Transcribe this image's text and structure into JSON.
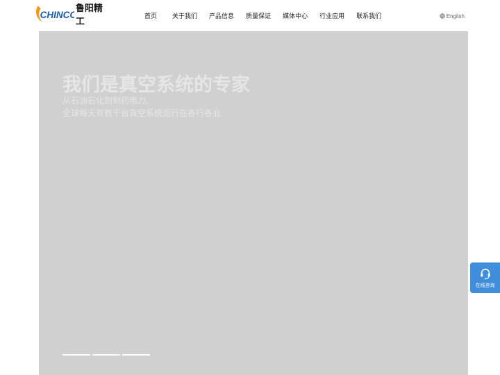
{
  "header": {
    "logo": {
      "brand_en": "CHINCO",
      "brand_cn": "鲁阳精工"
    },
    "nav": [
      {
        "label": "首页"
      },
      {
        "label": "关于我们"
      },
      {
        "label": "产品信息"
      },
      {
        "label": "质量保证"
      },
      {
        "label": "媒体中心"
      },
      {
        "label": "行业应用"
      },
      {
        "label": "联系我们"
      }
    ],
    "language": {
      "label": "English",
      "icon": "globe-icon"
    }
  },
  "hero": {
    "title": "我们是真空系统的专家",
    "subtitle_line1": "从石油石化到制药电力,",
    "subtitle_line2": "全球每天有数千台真空系统运行在各行各业",
    "slides_count": 3
  },
  "float_contact": {
    "label": "在线咨询",
    "icon": "headset-icon"
  },
  "colors": {
    "accent": "#3f8ddb",
    "hero_bg": "#d0d0d0",
    "logo_orange": "#f39a1e",
    "logo_blue": "#1f5aa8"
  }
}
